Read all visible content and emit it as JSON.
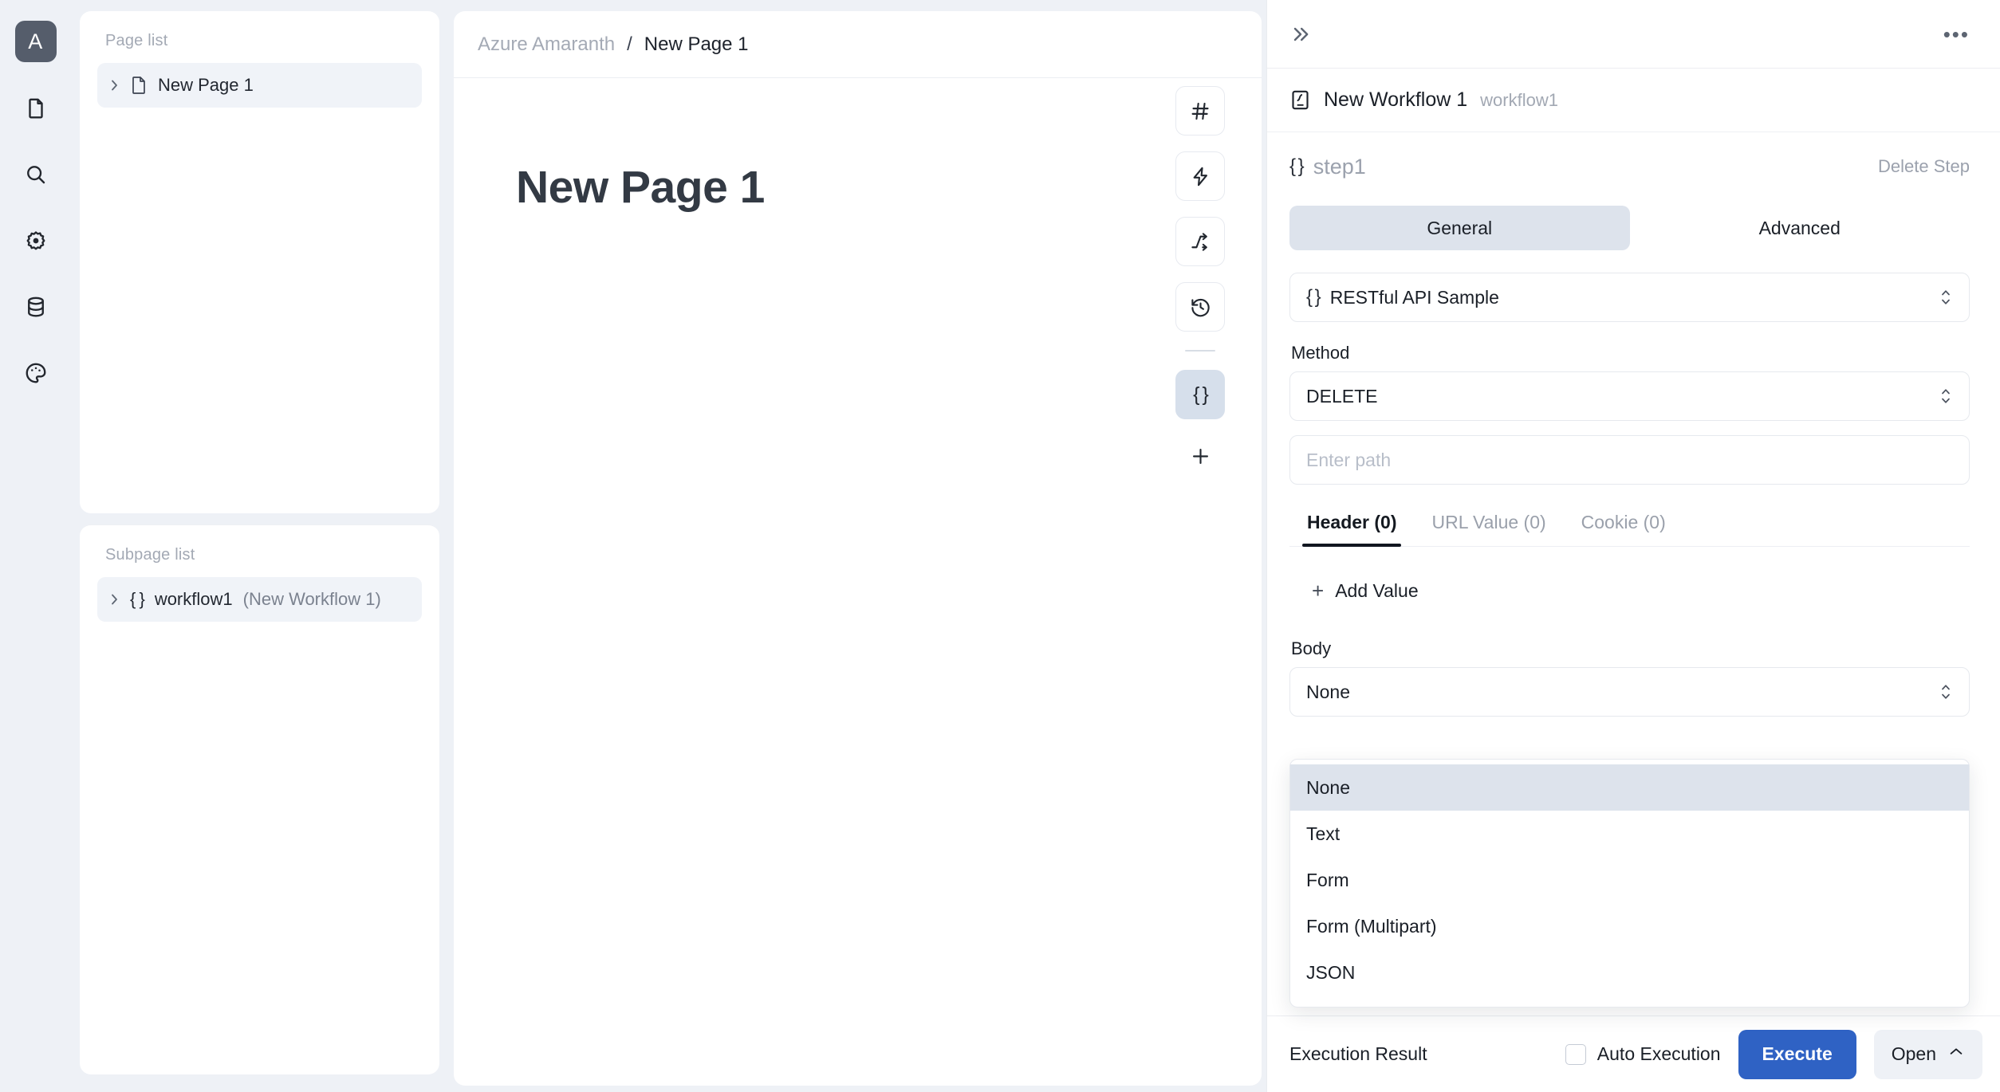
{
  "rail": {
    "logo": "A",
    "items": [
      {
        "name": "document-icon",
        "label": "Document"
      },
      {
        "name": "search-icon",
        "label": "Search"
      },
      {
        "name": "gear-icon",
        "label": "Settings"
      },
      {
        "name": "database-icon",
        "label": "Database"
      },
      {
        "name": "palette-icon",
        "label": "Theme"
      }
    ]
  },
  "page_list": {
    "title": "Page list",
    "items": [
      {
        "label": "New Page 1",
        "icon": "file-icon",
        "selected": true
      }
    ]
  },
  "subpage_list": {
    "title": "Subpage list",
    "items": [
      {
        "label": "workflow1",
        "suffix": " (New Workflow 1)",
        "icon": "braces-icon",
        "selected": true
      }
    ]
  },
  "breadcrumb": {
    "root": "Azure Amaranth",
    "separator": "/",
    "current": "New Page 1"
  },
  "canvas": {
    "title": "New Page 1"
  },
  "toolbar": {
    "buttons": [
      {
        "name": "hash-tool",
        "glyph": "#"
      },
      {
        "name": "lightning-tool",
        "glyph": "bolt"
      },
      {
        "name": "branch-tool",
        "glyph": "branch"
      },
      {
        "name": "history-tool",
        "glyph": "history"
      },
      {
        "name": "braces-tool",
        "glyph": "{ }",
        "active": true
      }
    ],
    "add_label": "+"
  },
  "right_panel": {
    "collapse_icon": "chevron-double-right-icon",
    "more_icon": "ellipsis-icon",
    "workflow": {
      "name": "New Workflow 1",
      "id": "workflow1"
    },
    "step": {
      "brace": "{ }",
      "name": "step1",
      "delete_label": "Delete Step"
    },
    "segments": [
      {
        "label": "General",
        "active": true
      },
      {
        "label": "Advanced",
        "active": false
      }
    ],
    "resource": {
      "brace": "{ }",
      "value": "RESTful API Sample"
    },
    "method": {
      "label": "Method",
      "value": "DELETE"
    },
    "path": {
      "placeholder": "Enter path",
      "value": ""
    },
    "param_tabs": [
      {
        "label": "Header (0)",
        "active": true
      },
      {
        "label": "URL Value (0)",
        "active": false
      },
      {
        "label": "Cookie (0)",
        "active": false
      }
    ],
    "add_value": {
      "plus": "+",
      "label": "Add Value"
    },
    "body": {
      "label": "Body",
      "value": "None",
      "options": [
        "None",
        "Text",
        "Form",
        "Form (Multipart)",
        "JSON"
      ],
      "selected_option": "None"
    },
    "footer": {
      "execution_result_label": "Execution Result",
      "auto_execution_label": "Auto Execution",
      "auto_execution_checked": false,
      "execute_label": "Execute",
      "open_label": "Open"
    }
  },
  "colors": {
    "accent": "#2f62c4",
    "logo_bg": "#555d6b",
    "selected_bg": "#dde3ec",
    "app_bg": "#eef1f6"
  }
}
